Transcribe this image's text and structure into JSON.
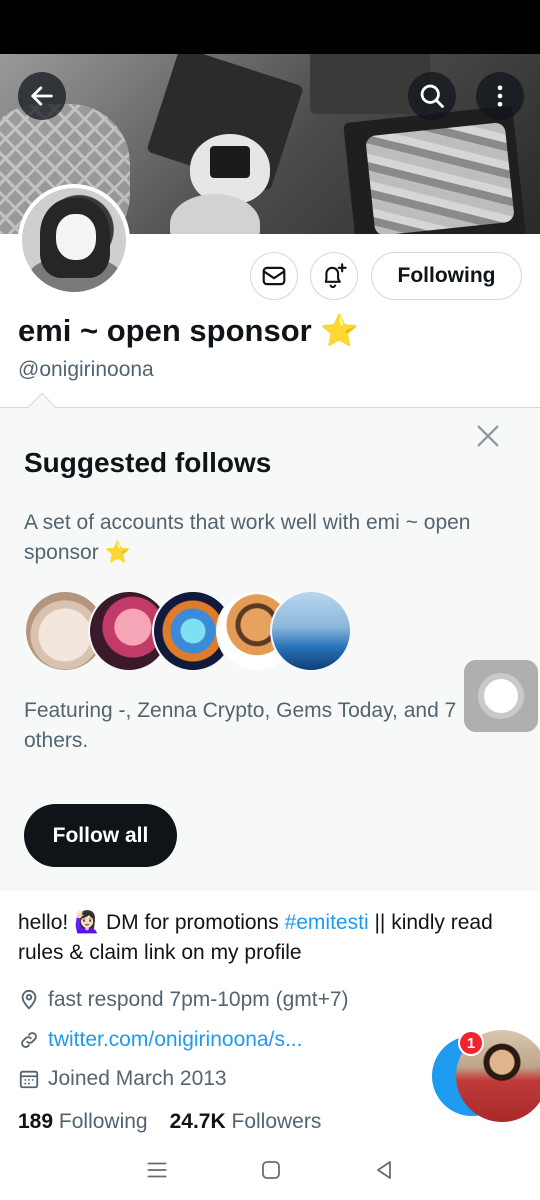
{
  "profile": {
    "display_name": "emi ~ open sponsor ⭐",
    "handle": "@onigirinoona",
    "following_label": "Following"
  },
  "suggested": {
    "title": "Suggested follows",
    "description": "A set of accounts that work well with emi ~ open sponsor ⭐",
    "featuring": "Featuring -, Zenna Crypto, Gems Today, and 7 others.",
    "follow_all_label": "Follow all"
  },
  "bio": {
    "text_before": "hello! 🙋🏻‍♀️ DM for promotions ",
    "hashtag": "#emitesti",
    "text_after": " || kindly read rules & claim link on my profile"
  },
  "meta": {
    "location": "fast respond 7pm-10pm (gmt+7)",
    "link": "twitter.com/onigirinoona/s...",
    "joined": "Joined March 2013"
  },
  "stats": {
    "following_count": "189",
    "following_label": "Following",
    "followers_count": "24.7K",
    "followers_label": "Followers"
  },
  "dm": {
    "badge_count": "1"
  },
  "icons": {
    "back": "arrow-left-icon",
    "search": "search-icon",
    "more": "more-vertical-icon",
    "message": "envelope-icon",
    "notify": "bell-plus-icon",
    "close": "close-icon",
    "location": "location-pin-icon",
    "link": "link-icon",
    "calendar": "calendar-icon"
  },
  "colors": {
    "accent": "#1d9bf0",
    "text": "#0f1419",
    "secondary": "#536471"
  }
}
